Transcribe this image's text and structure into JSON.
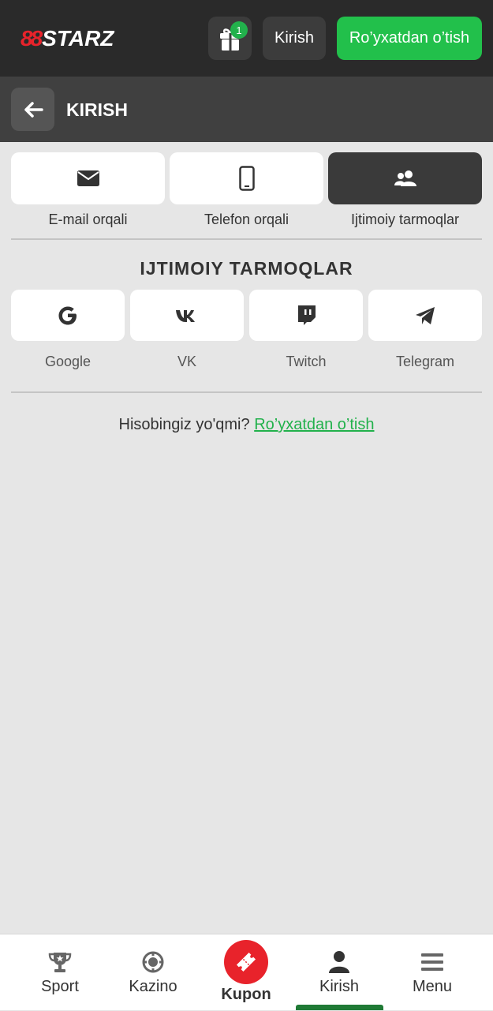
{
  "header": {
    "logo_mark": "88",
    "logo_text": "STARZ",
    "gift_icon": "gift-icon",
    "gift_badge_count": "1",
    "login_label": "Kirish",
    "register_label": "Ro’yxatdan o’tish"
  },
  "subheader": {
    "back_icon": "arrow-left-icon",
    "title": "KIRISH"
  },
  "methods": {
    "active_index": 2,
    "items": [
      {
        "label": "E-mail orqali",
        "icon": "envelope-icon"
      },
      {
        "label": "Telefon orqali",
        "icon": "phone-icon"
      },
      {
        "label": "Ijtimoiy tarmoqlar",
        "icon": "users-icon"
      }
    ]
  },
  "social": {
    "title": "IJTIMOIY TARMOQLAR",
    "items": [
      {
        "label": "Google",
        "icon": "google-icon"
      },
      {
        "label": "VK",
        "icon": "vk-icon"
      },
      {
        "label": "Twitch",
        "icon": "twitch-icon"
      },
      {
        "label": "Telegram",
        "icon": "telegram-icon"
      }
    ]
  },
  "signup": {
    "question": "Hisobingiz yo'qmi?",
    "link": "Ro’yxatdan o’tish"
  },
  "bottom_nav": {
    "active": "Kirish",
    "items": [
      {
        "label": "Sport",
        "icon": "trophy-icon"
      },
      {
        "label": "Kazino",
        "icon": "casino-chip-icon"
      },
      {
        "label": "Kupon",
        "icon": "ticket-icon"
      },
      {
        "label": "Kirish",
        "icon": "user-icon"
      },
      {
        "label": "Menu",
        "icon": "hamburger-icon"
      }
    ]
  },
  "colors": {
    "brand_red": "#e8232b",
    "accent_green": "#22c04b",
    "link_green": "#22b14c",
    "dark_header": "#2a2a2a"
  }
}
